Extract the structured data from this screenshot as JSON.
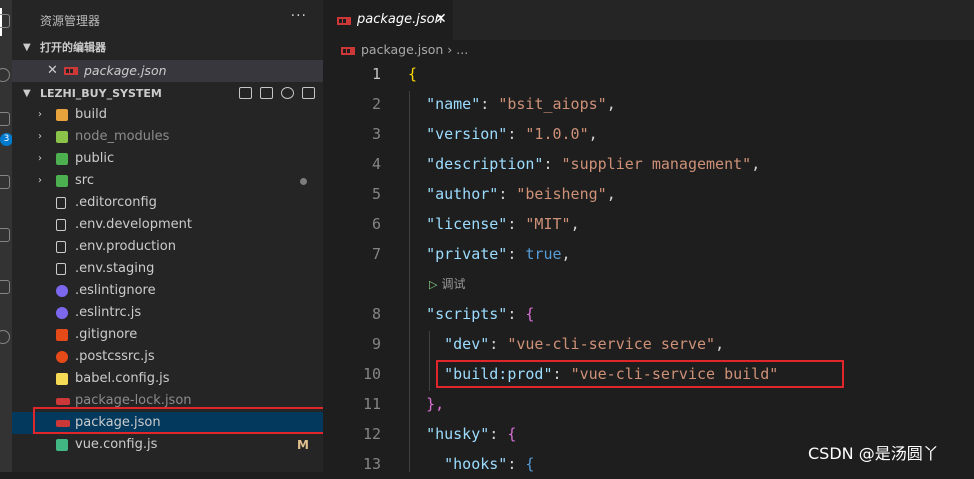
{
  "sidebar": {
    "title": "资源管理器",
    "more_label": "···",
    "open_editors": {
      "label": "打开的编辑器",
      "items": [
        {
          "close": "✕",
          "name": "package.json"
        }
      ]
    },
    "workspace": {
      "label": "LEZHI_BUY_SYSTEM",
      "items": [
        {
          "name": "build",
          "arrow": "›",
          "icon_color": "#e8a33d",
          "icon": "folder-icon"
        },
        {
          "name": "node_modules",
          "arrow": "›",
          "icon_color": "#8bc34a",
          "icon": "folder-node-icon"
        },
        {
          "name": "public",
          "arrow": "›",
          "icon_color": "#4caf50",
          "icon": "folder-public-icon"
        },
        {
          "name": "src",
          "arrow": "›",
          "icon_color": "#4caf50",
          "icon": "folder-src-icon"
        },
        {
          "name": ".editorconfig",
          "icon_color": "#cccccc",
          "icon": "editorconfig-icon"
        },
        {
          "name": ".env.development",
          "icon_color": "#cccccc",
          "icon": "file-icon"
        },
        {
          "name": ".env.production",
          "icon_color": "#cccccc",
          "icon": "file-icon"
        },
        {
          "name": ".env.staging",
          "icon_color": "#cccccc",
          "icon": "file-icon"
        },
        {
          "name": ".eslintignore",
          "icon_color": "#7b68ee",
          "icon": "eslint-icon"
        },
        {
          "name": ".eslintrc.js",
          "icon_color": "#7b68ee",
          "icon": "eslint-icon"
        },
        {
          "name": ".gitignore",
          "icon_color": "#e64a19",
          "icon": "git-icon"
        },
        {
          "name": ".postcssrc.js",
          "icon_color": "#e64a19",
          "icon": "postcss-icon"
        },
        {
          "name": "babel.config.js",
          "icon_color": "#f5da55",
          "icon": "babel-icon"
        },
        {
          "name": "package-lock.json",
          "icon_color": "#cb3837",
          "icon": "npm-icon"
        },
        {
          "name": "package.json",
          "icon_color": "#cb3837",
          "icon": "npm-icon"
        },
        {
          "name": "vue.config.js",
          "icon_color": "#41b883",
          "icon": "vue-icon",
          "status": "M"
        }
      ]
    }
  },
  "editor": {
    "tab": {
      "name": "package.json",
      "close": "✕"
    },
    "breadcrumb": {
      "file": "package.json",
      "sep": "›",
      "rest": "..."
    },
    "codelens": {
      "icon": "▷",
      "label": "调试"
    },
    "lines": [
      {
        "n": "1"
      },
      {
        "n": "2"
      },
      {
        "n": "3"
      },
      {
        "n": "4"
      },
      {
        "n": "5"
      },
      {
        "n": "6"
      },
      {
        "n": "7"
      },
      {
        "n": "8"
      },
      {
        "n": "9"
      },
      {
        "n": "10"
      },
      {
        "n": "11"
      },
      {
        "n": "12"
      },
      {
        "n": "13"
      }
    ],
    "code": {
      "l1": "{",
      "l2_k": "\"name\"",
      "l2_v": "\"bsit_aiops\"",
      "l3_k": "\"version\"",
      "l3_v": "\"1.0.0\"",
      "l4_k": "\"description\"",
      "l4_v": "\"supplier management\"",
      "l5_k": "\"author\"",
      "l5_v": "\"beisheng\"",
      "l6_k": "\"license\"",
      "l6_v": "\"MIT\"",
      "l7_k": "\"private\"",
      "l7_v": "true",
      "l8_k": "\"scripts\"",
      "l8_v": "{",
      "l9_k": "\"dev\"",
      "l9_v": "\"vue-cli-service serve\"",
      "l10_k": "\"build:prod\"",
      "l10_v": "\"vue-cli-service build\"",
      "l11": "},",
      "l12_k": "\"husky\"",
      "l12_v": "{",
      "l13_k": "\"hooks\"",
      "l13_v": "{"
    }
  },
  "watermark": "CSDN @是汤圆丫"
}
